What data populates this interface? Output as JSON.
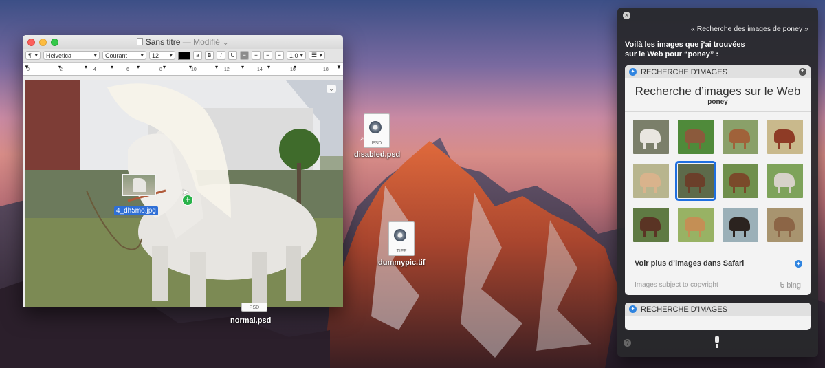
{
  "textedit": {
    "title": "Sans titre",
    "modified": "— Modifié",
    "toolbar": {
      "paragraph_style": "¶",
      "font_family": "Helvetica",
      "font_style": "Courant",
      "font_size": "12",
      "bold": "B",
      "italic": "I",
      "underline": "U",
      "line_spacing": "1,0"
    },
    "ruler_marks": [
      "0",
      "2",
      "4",
      "6",
      "8",
      "10",
      "12",
      "14",
      "16",
      "18"
    ],
    "drag_file_label": "4_dh5mo.jpg"
  },
  "desktop": {
    "files": [
      {
        "name": "disabled.psd",
        "type": "PSD"
      },
      {
        "name": "dummypic.tif",
        "type": "TIFF"
      },
      {
        "name": "normal.psd",
        "type": "PSD"
      }
    ]
  },
  "siri": {
    "query": "« Recherche des images de poney »",
    "answer_line1": "Voilà les images que j’ai trouvées",
    "answer_line2": "sur le Web pour “poney” :",
    "card": {
      "header": "RECHERCHE D’IMAGES",
      "title": "Recherche d’images sur le Web",
      "subtitle": "poney",
      "more_link": "Voir plus d’images dans Safari",
      "copyright": "Images subject to copyright",
      "provider": "bing"
    },
    "card2_header": "RECHERCHE D’IMAGES",
    "thumbnails": [
      {
        "bg": "#7b7f6a",
        "horse": "#e9e6e0"
      },
      {
        "bg": "#4f8a3a",
        "horse": "#8b5a3c"
      },
      {
        "bg": "#8aa069",
        "horse": "#a0623a"
      },
      {
        "bg": "#c9b98c",
        "horse": "#8e3b26"
      },
      {
        "bg": "#b8b58e",
        "horse": "#d9b38c"
      },
      {
        "bg": "#5d6a4a",
        "horse": "#6b3f2a"
      },
      {
        "bg": "#6f8f4c",
        "horse": "#7a4a2a"
      },
      {
        "bg": "#7ea35a",
        "horse": "#d7d2c8"
      },
      {
        "bg": "#5f7a43",
        "horse": "#5a3424"
      },
      {
        "bg": "#98b264",
        "horse": "#c48f55"
      },
      {
        "bg": "#9bb0b8",
        "horse": "#2b231f"
      },
      {
        "bg": "#a8946f",
        "horse": "#8c6546"
      }
    ],
    "selected_thumbnail": 5
  }
}
